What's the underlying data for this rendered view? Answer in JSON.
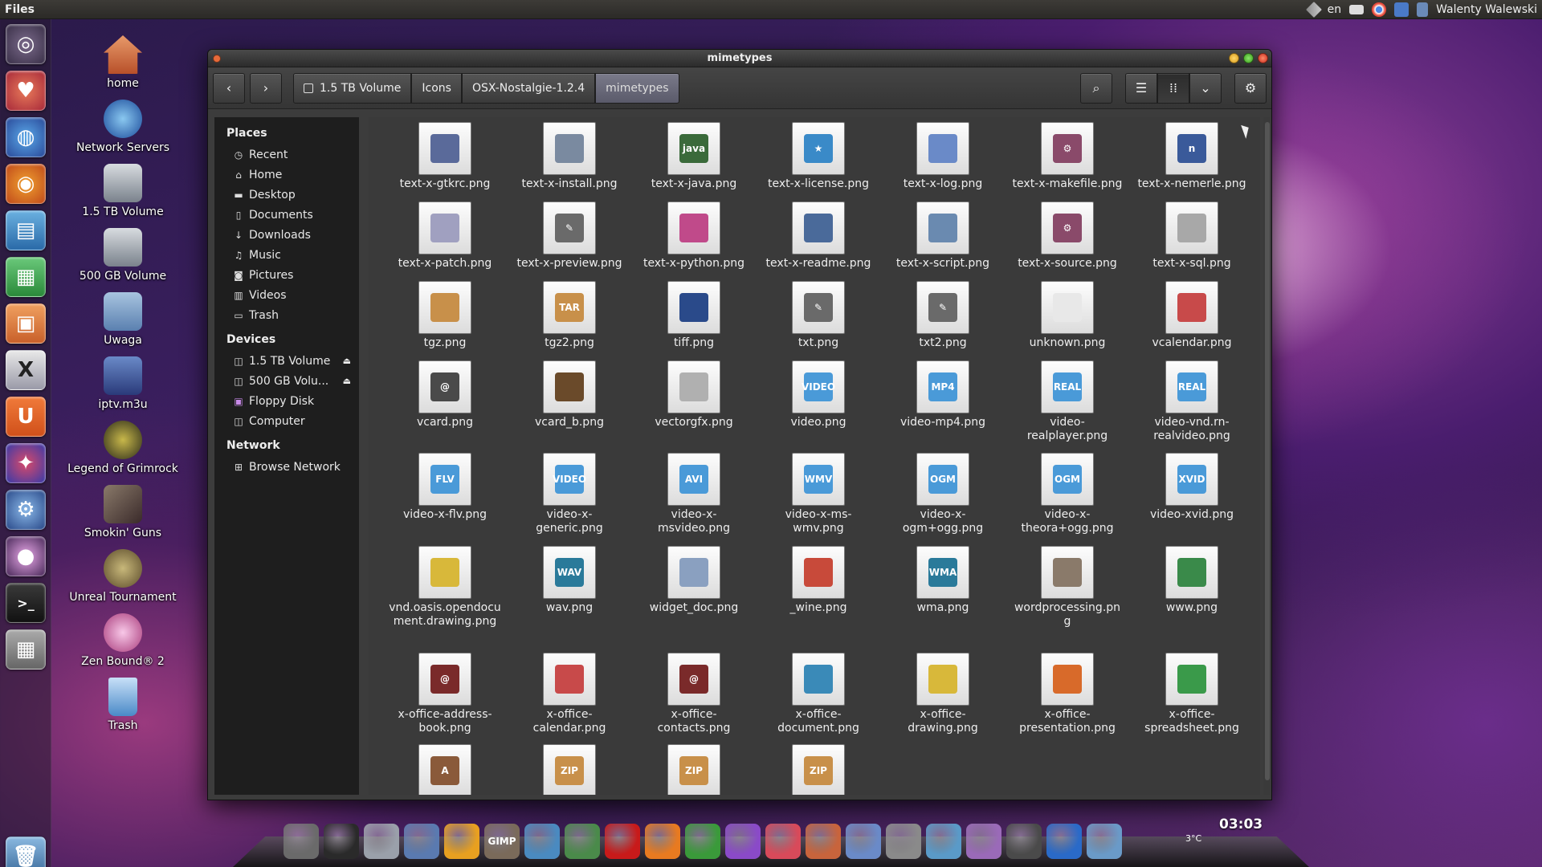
{
  "top_panel": {
    "app_name": "Files",
    "language": "en",
    "user": "Walenty Walewski"
  },
  "launcher": {
    "items": [
      "dash-home-icon",
      "heart-app-icon",
      "browser-icon",
      "firefox-icon",
      "libreoffice-writer-icon",
      "libreoffice-calc-icon",
      "libreoffice-impress-icon",
      "x11-app-icon",
      "ubuntu-software-icon",
      "app-icon",
      "settings-icon",
      "webcam-icon",
      "terminal-icon",
      "calculator-icon",
      "trash-icon"
    ]
  },
  "desktop": {
    "icons": [
      {
        "name": "home-folder",
        "label": "home",
        "color": "#c8643c"
      },
      {
        "name": "network-servers",
        "label": "Network Servers",
        "color": "#3b7ac0"
      },
      {
        "name": "volume-1-5tb",
        "label": "1.5 TB Volume",
        "color": "#9aa2ac"
      },
      {
        "name": "volume-500gb",
        "label": "500 GB Volume",
        "color": "#9aa2ac"
      },
      {
        "name": "uwaga",
        "label": "Uwaga",
        "color": "#6d8fb8"
      },
      {
        "name": "iptv",
        "label": "iptv.m3u",
        "color": "#3a4c8c"
      },
      {
        "name": "legend-of-grimrock",
        "label": "Legend of Grimrock",
        "color": "#4a4a3a"
      },
      {
        "name": "smokin-guns",
        "label": "Smokin' Guns",
        "color": "#5a4a40"
      },
      {
        "name": "unreal-tournament",
        "label": "Unreal Tournament",
        "color": "#7a6a40"
      },
      {
        "name": "zen-bound",
        "label": "Zen Bound® 2",
        "color": "#b05a8a"
      },
      {
        "name": "desktop-trash",
        "label": "Trash",
        "color": "#8ab4d8"
      }
    ]
  },
  "window": {
    "title": "mimetypes",
    "breadcrumbs": [
      "1.5 TB Volume",
      "Icons",
      "OSX-Nostalgie-1.2.4",
      "mimetypes"
    ],
    "sidebar": {
      "places_header": "Places",
      "places": [
        {
          "label": "Recent",
          "icon": "clock-icon"
        },
        {
          "label": "Home",
          "icon": "home-icon"
        },
        {
          "label": "Desktop",
          "icon": "folder-icon"
        },
        {
          "label": "Documents",
          "icon": "document-icon"
        },
        {
          "label": "Downloads",
          "icon": "download-icon"
        },
        {
          "label": "Music",
          "icon": "music-icon"
        },
        {
          "label": "Pictures",
          "icon": "camera-icon"
        },
        {
          "label": "Videos",
          "icon": "film-icon"
        },
        {
          "label": "Trash",
          "icon": "trash-icon"
        }
      ],
      "devices_header": "Devices",
      "devices": [
        {
          "label": "1.5 TB Volume",
          "icon": "drive-icon",
          "eject": true
        },
        {
          "label": "500 GB Volu...",
          "icon": "drive-icon",
          "eject": true
        },
        {
          "label": "Floppy Disk",
          "icon": "floppy-icon",
          "eject": false
        },
        {
          "label": "Computer",
          "icon": "drive-icon",
          "eject": false
        }
      ],
      "network_header": "Network",
      "network": [
        {
          "label": "Browse Network",
          "icon": "network-icon"
        }
      ]
    },
    "files": [
      {
        "name": "text-x-gtkrc.png",
        "glyph_color": "#5a6a9a",
        "glyph": ""
      },
      {
        "name": "text-x-install.png",
        "glyph_color": "#7a8aa0",
        "glyph": ""
      },
      {
        "name": "text-x-java.png",
        "glyph_color": "#3a6a3a",
        "glyph": "java"
      },
      {
        "name": "text-x-license.png",
        "glyph_color": "#3a8ac8",
        "glyph": "★"
      },
      {
        "name": "text-x-log.png",
        "glyph_color": "#6a8ac8",
        "glyph": ""
      },
      {
        "name": "text-x-makefile.png",
        "glyph_color": "#8a4a6a",
        "glyph": "⚙"
      },
      {
        "name": "text-x-nemerle.png",
        "glyph_color": "#3a5a9a",
        "glyph": "n"
      },
      {
        "name": "text-x-patch.png",
        "glyph_color": "#a0a0c0",
        "glyph": ""
      },
      {
        "name": "text-x-preview.png",
        "glyph_color": "#6a6a6a",
        "glyph": "✎"
      },
      {
        "name": "text-x-python.png",
        "glyph_color": "#c04a8a",
        "glyph": ""
      },
      {
        "name": "text-x-readme.png",
        "glyph_color": "#4a6a9a",
        "glyph": ""
      },
      {
        "name": "text-x-script.png",
        "glyph_color": "#6a8ab0",
        "glyph": ""
      },
      {
        "name": "text-x-source.png",
        "glyph_color": "#8a4a6a",
        "glyph": "⚙"
      },
      {
        "name": "text-x-sql.png",
        "glyph_color": "#a8a8a8",
        "glyph": ""
      },
      {
        "name": "tgz.png",
        "glyph_color": "#c8904a",
        "glyph": ""
      },
      {
        "name": "tgz2.png",
        "glyph_color": "#c8904a",
        "glyph": "TAR"
      },
      {
        "name": "tiff.png",
        "glyph_color": "#2a4a8a",
        "glyph": ""
      },
      {
        "name": "txt.png",
        "glyph_color": "#6a6a6a",
        "glyph": "✎"
      },
      {
        "name": "txt2.png",
        "glyph_color": "#6a6a6a",
        "glyph": "✎"
      },
      {
        "name": "unknown.png",
        "glyph_color": "#e8e8e8",
        "glyph": ""
      },
      {
        "name": "vcalendar.png",
        "glyph_color": "#c84a4a",
        "glyph": ""
      },
      {
        "name": "vcard.png",
        "glyph_color": "#4a4a4a",
        "glyph": "@"
      },
      {
        "name": "vcard_b.png",
        "glyph_color": "#6a4a2a",
        "glyph": ""
      },
      {
        "name": "vectorgfx.png",
        "glyph_color": "#b0b0b0",
        "glyph": ""
      },
      {
        "name": "video.png",
        "glyph_color": "#4a9ad8",
        "glyph": "VIDEO"
      },
      {
        "name": "video-mp4.png",
        "glyph_color": "#4a9ad8",
        "glyph": "MP4"
      },
      {
        "name": "video-realplayer.png",
        "glyph_color": "#4a9ad8",
        "glyph": "REAL"
      },
      {
        "name": "video-vnd.rn-realvideo.png",
        "glyph_color": "#4a9ad8",
        "glyph": "REAL"
      },
      {
        "name": "video-x-flv.png",
        "glyph_color": "#4a9ad8",
        "glyph": "FLV"
      },
      {
        "name": "video-x-generic.png",
        "glyph_color": "#4a9ad8",
        "glyph": "VIDEO"
      },
      {
        "name": "video-x-msvideo.png",
        "glyph_color": "#4a9ad8",
        "glyph": "AVI"
      },
      {
        "name": "video-x-ms-wmv.png",
        "glyph_color": "#4a9ad8",
        "glyph": "WMV"
      },
      {
        "name": "video-x-ogm+ogg.png",
        "glyph_color": "#4a9ad8",
        "glyph": "OGM"
      },
      {
        "name": "video-x-theora+ogg.png",
        "glyph_color": "#4a9ad8",
        "glyph": "OGM"
      },
      {
        "name": "video-xvid.png",
        "glyph_color": "#4a9ad8",
        "glyph": "XVID"
      },
      {
        "name": "vnd.oasis.opendocument.drawing.png",
        "glyph_color": "#d8b83a",
        "glyph": ""
      },
      {
        "name": "wav.png",
        "glyph_color": "#2a7a9a",
        "glyph": "WAV"
      },
      {
        "name": "widget_doc.png",
        "glyph_color": "#8aa0c0",
        "glyph": ""
      },
      {
        "name": "_wine.png",
        "glyph_color": "#c84a3a",
        "glyph": ""
      },
      {
        "name": "wma.png",
        "glyph_color": "#2a7a9a",
        "glyph": "WMA"
      },
      {
        "name": "wordprocessing.png",
        "glyph_color": "#8a7a6a",
        "glyph": ""
      },
      {
        "name": "www.png",
        "glyph_color": "#3a8a4a",
        "glyph": ""
      },
      {
        "name": "x-office-address-book.png",
        "glyph_color": "#7a2a2a",
        "glyph": "@"
      },
      {
        "name": "x-office-calendar.png",
        "glyph_color": "#c84a4a",
        "glyph": ""
      },
      {
        "name": "x-office-contacts.png",
        "glyph_color": "#7a2a2a",
        "glyph": "@"
      },
      {
        "name": "x-office-document.png",
        "glyph_color": "#3a8ab8",
        "glyph": ""
      },
      {
        "name": "x-office-drawing.png",
        "glyph_color": "#d8b83a",
        "glyph": ""
      },
      {
        "name": "x-office-presentation.png",
        "glyph_color": "#d86a2a",
        "glyph": ""
      },
      {
        "name": "x-office-spreadsheet.png",
        "glyph_color": "#3a9a4a",
        "glyph": ""
      },
      {
        "name": "",
        "glyph_color": "#8a5a3a",
        "glyph": "A"
      },
      {
        "name": "",
        "glyph_color": "#c8904a",
        "glyph": "ZIP"
      },
      {
        "name": "",
        "glyph_color": "#c8904a",
        "glyph": "ZIP"
      },
      {
        "name": "",
        "glyph_color": "#c8904a",
        "glyph": "ZIP"
      }
    ]
  },
  "dock": {
    "items": [
      {
        "icon": "apple-icon",
        "color": "#6a6a6a",
        "label": ""
      },
      {
        "icon": "terminal-icon",
        "color": "#2a2a2a",
        "label": ""
      },
      {
        "icon": "x11-icon",
        "color": "#9aa0aa",
        "label": ""
      },
      {
        "icon": "preview-icon",
        "color": "#5a7ab0",
        "label": ""
      },
      {
        "icon": "sun-icon",
        "color": "#e8a020",
        "label": ""
      },
      {
        "icon": "gimp-icon",
        "color": "#7a6a5a",
        "label": "GIMP"
      },
      {
        "icon": "writer-icon",
        "color": "#4a8ac0",
        "label": ""
      },
      {
        "icon": "contacts-icon",
        "color": "#4a8a4a",
        "label": ""
      },
      {
        "icon": "opera-icon",
        "color": "#c81a1a",
        "label": ""
      },
      {
        "icon": "firefox-icon",
        "color": "#e87a20",
        "label": ""
      },
      {
        "icon": "chrome-icon",
        "color": "#3a9a3a",
        "label": ""
      },
      {
        "icon": "nero-icon",
        "color": "#8a4ac8",
        "label": ""
      },
      {
        "icon": "heart-icon",
        "color": "#d84a5a",
        "label": ""
      },
      {
        "icon": "home-icon",
        "color": "#c8643c",
        "label": ""
      },
      {
        "icon": "applications-icon",
        "color": "#6a8ac8",
        "label": ""
      },
      {
        "icon": "search-icon",
        "color": "#8a8a8a",
        "label": ""
      },
      {
        "icon": "downloads-icon",
        "color": "#5a9ac8",
        "label": ""
      },
      {
        "icon": "folder-icon",
        "color": "#9a6ab8",
        "label": ""
      },
      {
        "icon": "power-icon",
        "color": "#4a4a4a",
        "label": ""
      },
      {
        "icon": "accessibility-icon",
        "color": "#2a6ac8",
        "label": ""
      },
      {
        "icon": "documents-icon",
        "color": "#6a9ac8",
        "label": ""
      }
    ],
    "weather": "3°C",
    "clock": "03:03"
  }
}
